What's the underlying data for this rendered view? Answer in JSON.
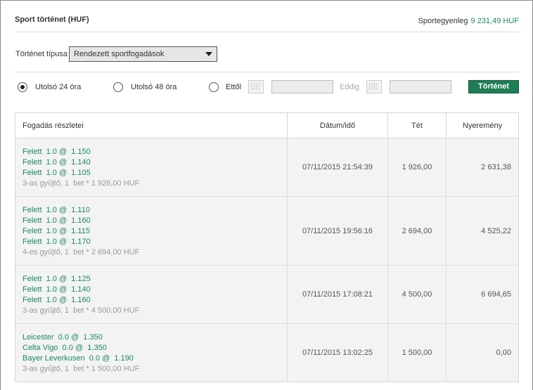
{
  "header": {
    "title": "Sport történet (HUF)",
    "balance_label": "Sportegyenleg",
    "balance_amount": "9 231,49 HUF"
  },
  "filter": {
    "type_label": "Történet típusa",
    "type_value": "Rendezett sportfogadások",
    "radio_24h": "Utolsó 24 óra",
    "radio_48h": "Utolsó 48 óra",
    "radio_from": "Ettől",
    "until_label": "Eddig",
    "submit_label": "Történet",
    "selected_range": "24h"
  },
  "table": {
    "headers": [
      "Fogadás részletei",
      "Dátum/idő",
      "Tét",
      "Nyeremény"
    ],
    "rows": [
      {
        "selections": [
          "Felett  1.0 @  1.150",
          "Felett  1.0 @  1.140",
          "Felett  1.0 @  1.105"
        ],
        "summary": "3-as gyűjtő, 1  bet * 1 926,00 HUF",
        "datetime": "07/11/2015 21:54:39",
        "stake": "1 926,00",
        "winnings": "2 631,38"
      },
      {
        "selections": [
          "Felett  1.0 @  1.110",
          "Felett  1.0 @  1.160",
          "Felett  1.0 @  1.115",
          "Felett  1.0 @  1.170"
        ],
        "summary": "4-es gyűjtő, 1  bet * 2 694,00 HUF",
        "datetime": "07/11/2015 19:56:16",
        "stake": "2 694,00",
        "winnings": "4 525,22"
      },
      {
        "selections": [
          "Felett  1.0 @  1.125",
          "Felett  1.0 @  1.140",
          "Felett  1.0 @  1.160"
        ],
        "summary": "3-as gyűjtő, 1  bet * 4 500,00 HUF",
        "datetime": "07/11/2015 17:08:21",
        "stake": "4 500,00",
        "winnings": "6 694,65"
      },
      {
        "selections": [
          "Leicester  0.0 @  1.350",
          "Celta Vigo  0.0 @  1.350",
          "Bayer Leverkusen  0.0 @  1.190"
        ],
        "summary": "3-as gyűjtő, 1  bet * 1 500,00 HUF",
        "datetime": "07/11/2015 13:02:25",
        "stake": "1 500,00",
        "winnings": "0,00"
      }
    ]
  }
}
